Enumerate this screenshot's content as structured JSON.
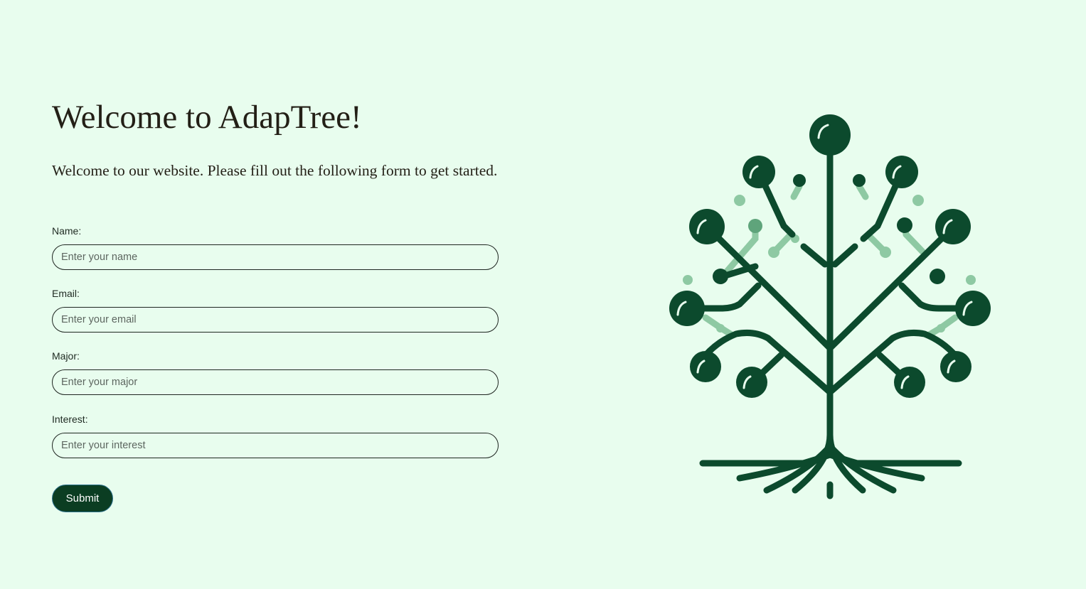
{
  "page": {
    "title": "Welcome to AdapTree!",
    "subtitle": "Welcome to our website. Please fill out the following form to get started."
  },
  "form": {
    "fields": [
      {
        "label": "Name:",
        "placeholder": "Enter your name",
        "value": ""
      },
      {
        "label": "Email:",
        "placeholder": "Enter your email",
        "value": ""
      },
      {
        "label": "Major:",
        "placeholder": "Enter your major",
        "value": ""
      },
      {
        "label": "Interest:",
        "placeholder": "Enter your interest",
        "value": ""
      }
    ],
    "submit_label": "Submit"
  },
  "illustration": {
    "icon": "tree-circuit-logo",
    "colors": {
      "dark": "#0c4a2d",
      "light": "#8ec9a3",
      "background": "#e8fdee"
    }
  }
}
